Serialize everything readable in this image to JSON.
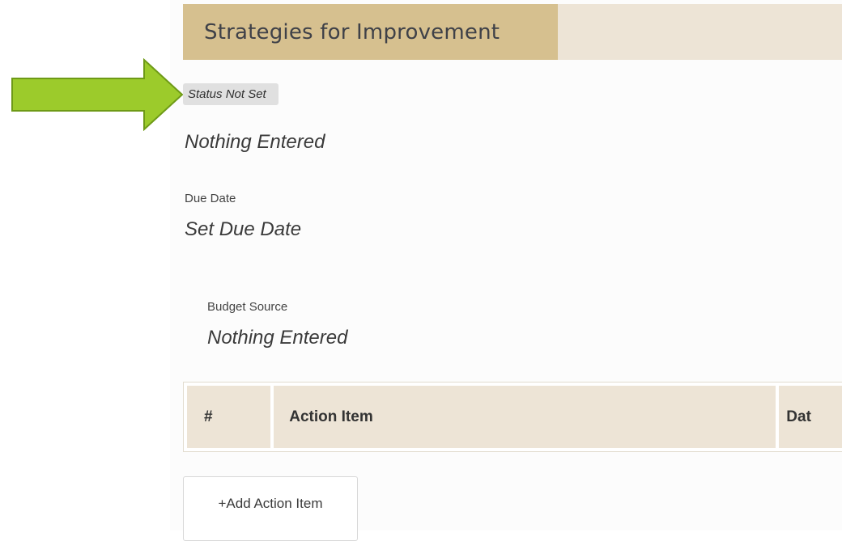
{
  "section": {
    "title": "Strategies for Improvement",
    "header_color": "#d6c08f",
    "band_color": "#ede4d6"
  },
  "status": {
    "label": "Status Not Set"
  },
  "description": {
    "value": "Nothing Entered"
  },
  "due_date": {
    "label": "Due Date",
    "value": "Set Due Date"
  },
  "budget_source": {
    "label": "Budget Source",
    "value": "Nothing Entered"
  },
  "action_table": {
    "headers": [
      "#",
      "Action Item",
      "Dat"
    ]
  },
  "add_action_button": {
    "label": "+Add Action Item"
  },
  "annotation": {
    "icon": "green-arrow-icon",
    "color": "#9ccb2b"
  }
}
